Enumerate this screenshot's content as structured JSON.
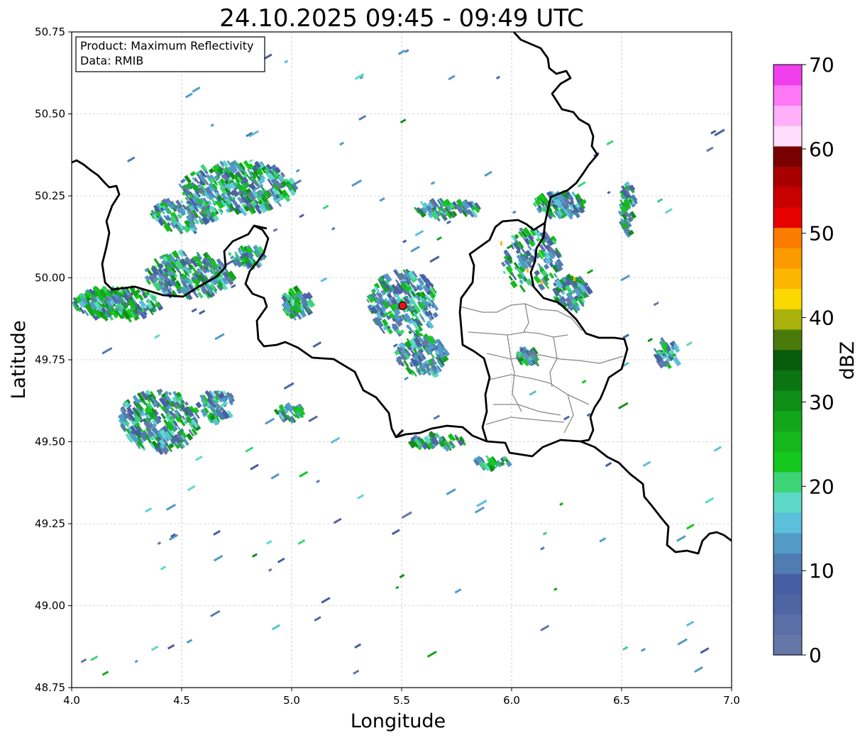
{
  "title": "24.10.2025 09:45 - 09:49 UTC",
  "info_box": {
    "product": "Product: Maximum Reflectivity",
    "source": "Data: RMIB"
  },
  "axes": {
    "xlabel": "Longitude",
    "ylabel": "Latitude",
    "xlim": [
      4.0,
      7.0
    ],
    "ylim": [
      48.75,
      50.75
    ],
    "xticks": [
      "4.0",
      "4.5",
      "5.0",
      "5.5",
      "6.0",
      "6.5",
      "7.0"
    ],
    "yticks": [
      "48.75",
      "49.00",
      "49.25",
      "49.50",
      "49.75",
      "50.00",
      "50.25",
      "50.50",
      "50.75"
    ],
    "grid": true
  },
  "radar_site": {
    "lon": 5.505,
    "lat": 49.915,
    "color": "#e8141c"
  },
  "colorbar": {
    "label": "dBZ",
    "range": [
      0,
      70
    ],
    "ticks": [
      "0",
      "10",
      "20",
      "30",
      "40",
      "50",
      "60",
      "70"
    ],
    "colors": [
      "#6577a6",
      "#5c6fa6",
      "#4e64a3",
      "#465ea3",
      "#4f7cb2",
      "#539ac6",
      "#5cbfdb",
      "#5ed8c8",
      "#3dd478",
      "#14c81e",
      "#14b81c",
      "#12a61a",
      "#0f8e17",
      "#0b7512",
      "#075c0c",
      "#4a7a0a",
      "#a8b20a",
      "#fbd800",
      "#fbb600",
      "#fb9a00",
      "#fb7c00",
      "#e60000",
      "#c80000",
      "#a80000",
      "#7a0000",
      "#ffdcfa",
      "#ffb0f8",
      "#ff78f6",
      "#f040ee"
    ]
  }
}
